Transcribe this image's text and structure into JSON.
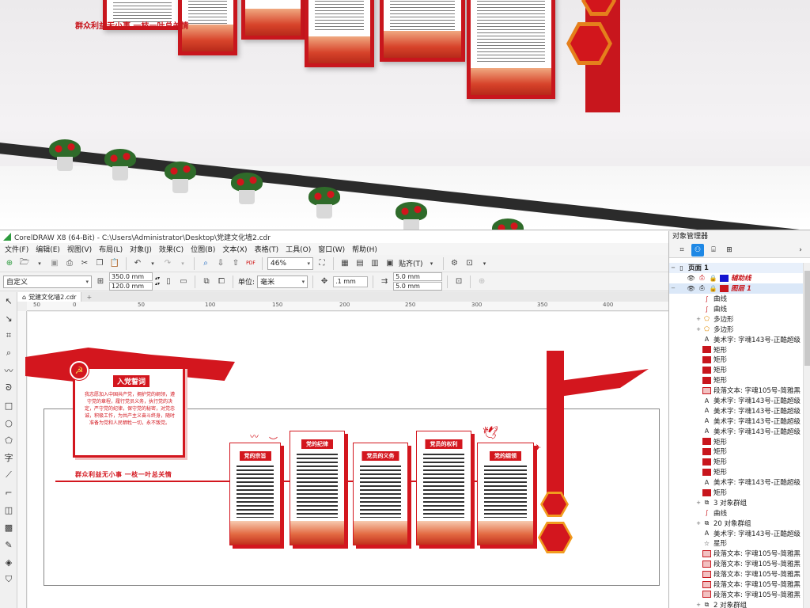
{
  "photo": {
    "slogan": "群众利益无小事  一枝一叶总关情"
  },
  "app": {
    "title": "CorelDRAW X8 (64-Bit) - C:\\Users\\Administrator\\Desktop\\党建文化墙2.cdr",
    "menu": [
      "文件(F)",
      "编辑(E)",
      "视图(V)",
      "布局(L)",
      "对象(J)",
      "效果(C)",
      "位图(B)",
      "文本(X)",
      "表格(T)",
      "工具(O)",
      "窗口(W)",
      "帮助(H)"
    ],
    "toolbar": {
      "zoom": "46%",
      "snap_label": "贴齐(T)",
      "pdf_label": "PDF"
    },
    "property_bar": {
      "preset": "自定义",
      "width": "350.0 mm",
      "height": "120.0 mm",
      "units_label": "单位:",
      "units": "毫米",
      "nudge": ".1 mm",
      "dup_x": "5.0 mm",
      "dup_y": "5.0 mm"
    },
    "doc_tab": "党建文化墙2.cdr",
    "ruler_labels": [
      "50",
      "0",
      "50",
      "100",
      "150",
      "200",
      "250",
      "300",
      "350",
      "400"
    ]
  },
  "artwork": {
    "oath_title": "入党誓词",
    "oath_text": "我志愿加入中国共产党，拥护党的纲领，遵守党的章程，履行党员义务，执行党的决定，严守党的纪律，保守党的秘密，对党忠诚，积极工作，为共产主义奋斗终身，随时准备为党和人民牺牲一切，永不叛党。",
    "slogan": "群众利益无小事  一枝一叶总关情",
    "cards": [
      "党的宗旨",
      "党的纪律",
      "党员的义务",
      "党员的权利",
      "党的纲领"
    ]
  },
  "object_manager": {
    "title": "对象管理器",
    "page": "页面 1",
    "layers": [
      {
        "label": "辅助线",
        "swatch": "#1414d0"
      },
      {
        "label": "图层 1",
        "swatch": "#c8161d"
      }
    ],
    "items": [
      {
        "icon": "curve",
        "label": "曲线"
      },
      {
        "icon": "curve",
        "label": "曲线"
      },
      {
        "icon": "polygon",
        "label": "多边形",
        "expand": "+"
      },
      {
        "icon": "polygon",
        "label": "多边形",
        "expand": "+"
      },
      {
        "icon": "artistic-text",
        "label": "美术字: 字魂143号-正酷超级"
      },
      {
        "icon": "rect-red",
        "label": "矩形"
      },
      {
        "icon": "rect-red",
        "label": "矩形"
      },
      {
        "icon": "rect-red",
        "label": "矩形"
      },
      {
        "icon": "rect-red",
        "label": "矩形"
      },
      {
        "icon": "rect-pink",
        "label": "段落文本: 字魂105号-简雅黑"
      },
      {
        "icon": "artistic-text",
        "label": "美术字: 字魂143号-正酷超级"
      },
      {
        "icon": "artistic-text",
        "label": "美术字: 字魂143号-正酷超级"
      },
      {
        "icon": "artistic-text",
        "label": "美术字: 字魂143号-正酷超级"
      },
      {
        "icon": "artistic-text",
        "label": "美术字: 字魂143号-正酷超级"
      },
      {
        "icon": "rect-red",
        "label": "矩形"
      },
      {
        "icon": "rect-red",
        "label": "矩形"
      },
      {
        "icon": "rect-red",
        "label": "矩形"
      },
      {
        "icon": "rect-red",
        "label": "矩形"
      },
      {
        "icon": "artistic-text",
        "label": "美术字: 字魂143号-正酷超级"
      },
      {
        "icon": "rect-red",
        "label": "矩形"
      },
      {
        "icon": "group",
        "label": "3 对象群组",
        "expand": "+"
      },
      {
        "icon": "curve",
        "label": "曲线"
      },
      {
        "icon": "group",
        "label": "20 对象群组",
        "expand": "+"
      },
      {
        "icon": "artistic-text",
        "label": "美术字: 字魂143号-正酷超级"
      },
      {
        "icon": "star",
        "label": "星形"
      },
      {
        "icon": "rect-pink",
        "label": "段落文本: 字魂105号-简雅黑"
      },
      {
        "icon": "rect-pink",
        "label": "段落文本: 字魂105号-简雅黑"
      },
      {
        "icon": "rect-pink",
        "label": "段落文本: 字魂105号-简雅黑"
      },
      {
        "icon": "rect-pink",
        "label": "段落文本: 字魂105号-简雅黑"
      },
      {
        "icon": "rect-pink",
        "label": "段落文本: 字魂105号-简雅黑"
      },
      {
        "icon": "group",
        "label": "2 对象群组",
        "expand": "+"
      }
    ]
  },
  "colors": {
    "party_red": "#d3161e",
    "accent_orange": "#f19b1f",
    "selection_blue": "#1e88e5"
  }
}
